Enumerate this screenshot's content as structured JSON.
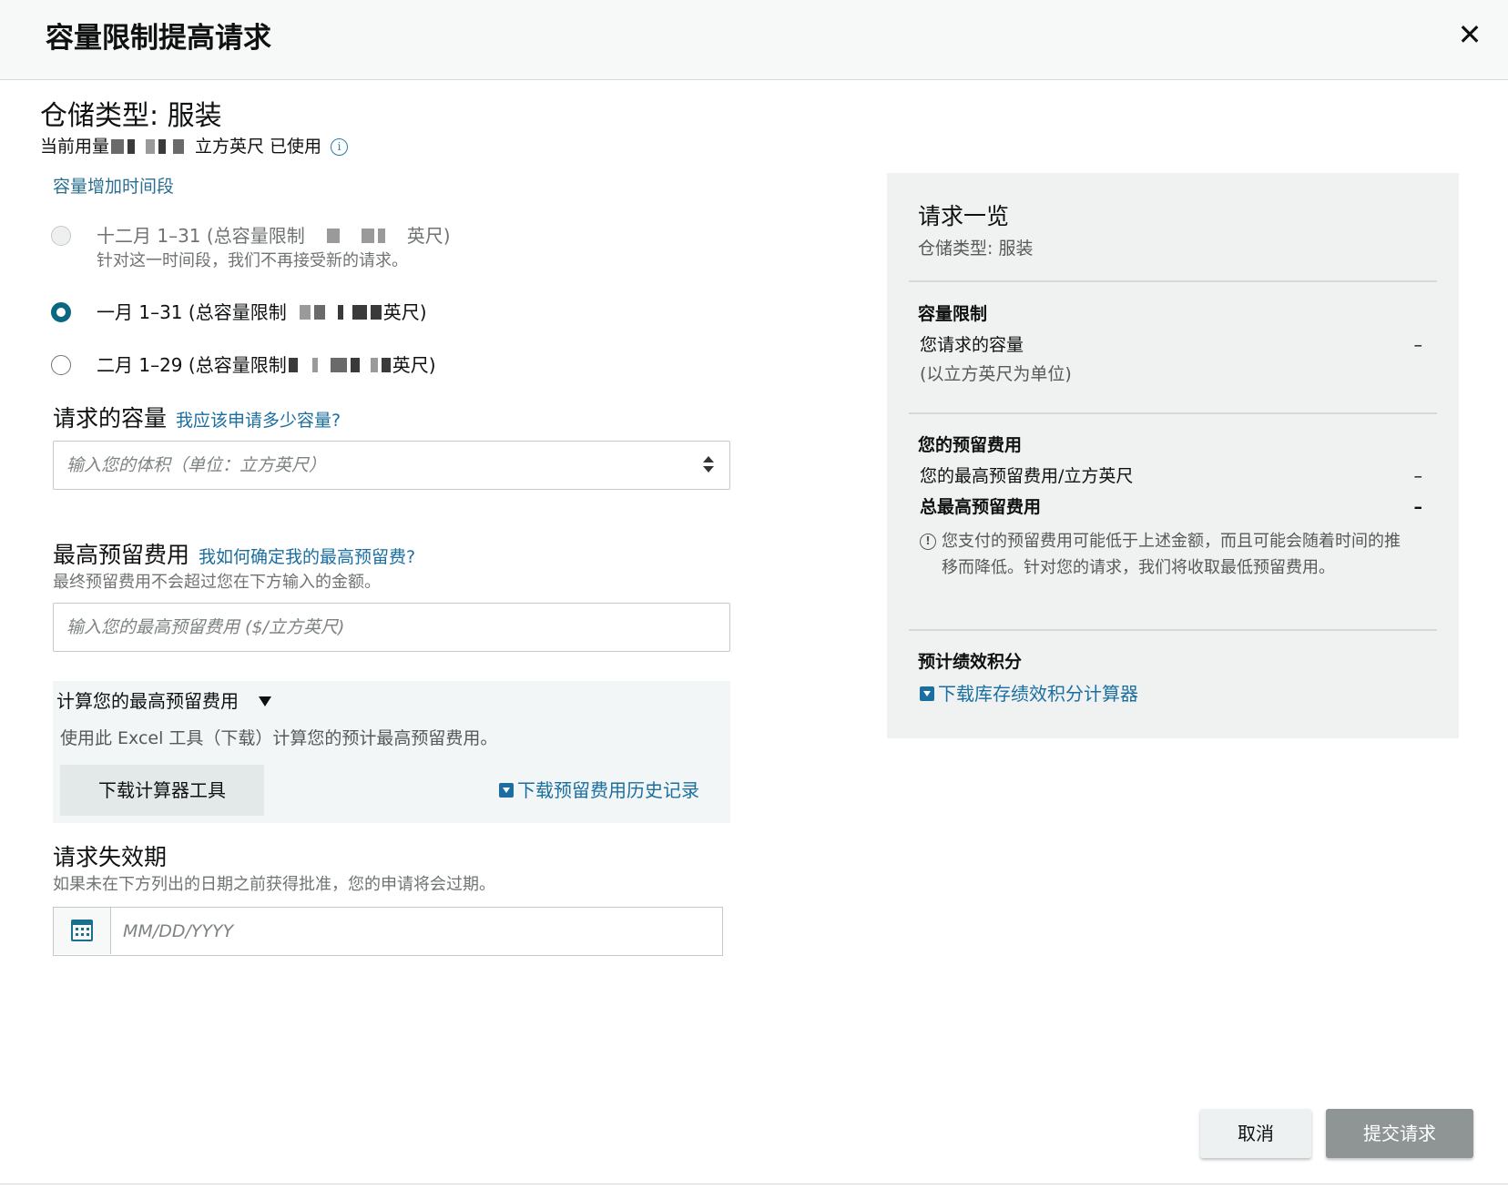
{
  "dialog": {
    "title": "容量限制提高请求",
    "close_label": "✕"
  },
  "storage": {
    "type_label": "仓储类型: 服装",
    "usage_prefix": "当前用量",
    "usage_suffix": "立方英尺 已使用",
    "info_icon": "i"
  },
  "periods": {
    "heading": "容量增加时间段",
    "options": [
      {
        "text_prefix": "十二月 1–31 (总容量限制",
        "text_suffix": "英尺)",
        "note": "针对这一时间段，我们不再接受新的请求。",
        "state": "disabled"
      },
      {
        "text_prefix": "一月 1–31 (总容量限制",
        "text_suffix": "英尺)",
        "state": "checked"
      },
      {
        "text_prefix": "二月 1–29 (总容量限制",
        "text_suffix": "英尺)",
        "state": "unchecked"
      }
    ]
  },
  "capacity": {
    "label": "请求的容量",
    "help_link": "我应该申请多少容量?",
    "placeholder": "输入您的体积（单位：立方英尺）"
  },
  "reserve_fee": {
    "label": "最高预留费用",
    "help_link": "我如何确定我的最高预留费?",
    "sub": "最终预留费用不会超过您在下方输入的金额。",
    "placeholder": "输入您的最高预留费用 ($/立方英尺)"
  },
  "calculator": {
    "title": "计算您的最高预留费用",
    "desc": "使用此 Excel 工具（下载）计算您的预计最高预留费用。",
    "button": "下载计算器工具",
    "history_link": "下载预留费用历史记录"
  },
  "expiry": {
    "label": "请求失效期",
    "sub": "如果未在下方列出的日期之前获得批准，您的申请将会过期。",
    "placeholder": "MM/DD/YYYY"
  },
  "summary": {
    "title": "请求一览",
    "sub": "仓储类型: 服装",
    "capacity_heading": "容量限制",
    "requested_capacity": "您请求的容量",
    "requested_value": "–",
    "unit_note": "(以立方英尺为单位)",
    "fee_heading": "您的预留费用",
    "max_fee_per_unit": "您的最高预留费用/立方英尺",
    "max_fee_per_unit_value": "–",
    "total_max_fee": "总最高预留费用",
    "total_max_fee_value": "–",
    "note": "您支付的预留费用可能低于上述金额，而且可能会随着时间的推移而降低。针对您的请求，我们将收取最低预留费用。",
    "score_heading": "预计绩效积分",
    "score_link": "下载库存绩效积分计算器"
  },
  "actions": {
    "cancel": "取消",
    "submit": "提交请求"
  }
}
